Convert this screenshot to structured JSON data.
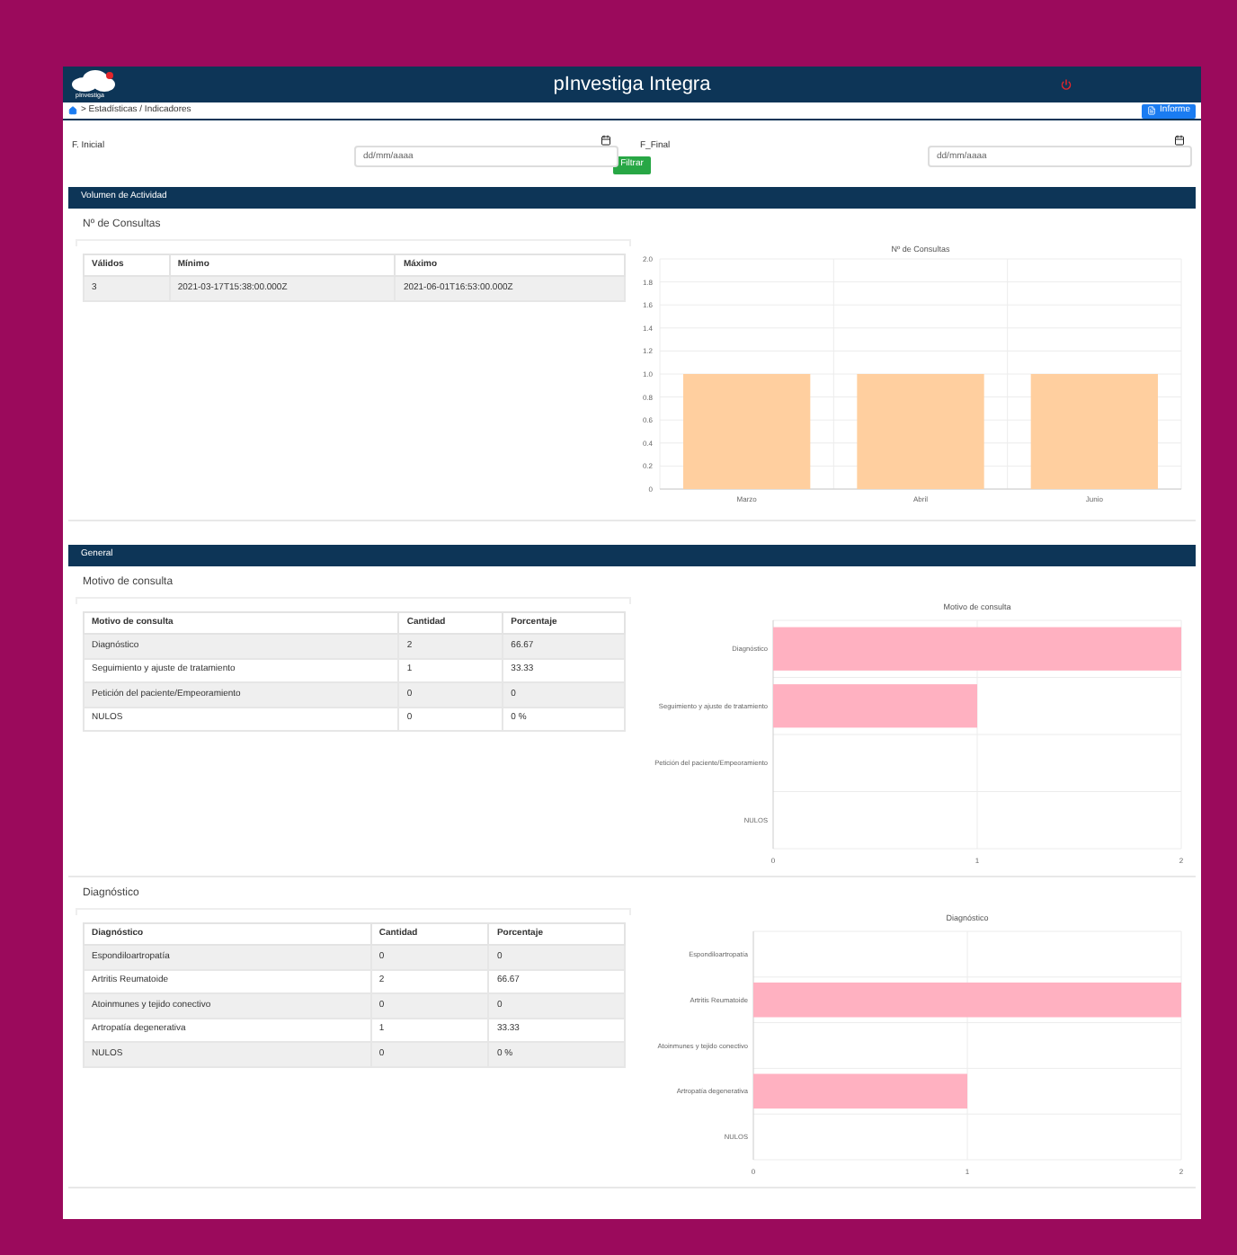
{
  "header": {
    "logo_text": "pInvestiga",
    "title": "pInvestiga Integra"
  },
  "breadcrumb": "> Estadísticas / Indicadores",
  "report_button": "Informe",
  "filters": [
    {
      "label": "F. Inicial",
      "placeholder": "dd/mm/aaaa"
    },
    {
      "label": "F_Final",
      "placeholder": "dd/mm/aaaa"
    }
  ],
  "filter_button": "Filtrar",
  "sections": [
    {
      "title": "Volumen de Actividad",
      "panels": [
        {
          "title": "Nº de Consultas",
          "table": {
            "columns": [
              "Válidos",
              "Mínimo",
              "Máximo"
            ],
            "rows": [
              [
                "3",
                "2021-03-17T15:38:00.000Z",
                "2021-06-01T16:53:00.000Z"
              ]
            ]
          },
          "chart_data": {
            "type": "bar",
            "orientation": "vertical",
            "title": "Nº de Consultas",
            "categories": [
              "Marzo",
              "Abril",
              "Junio"
            ],
            "series": [
              {
                "color": "#ffcf9f",
                "values": [
                  1,
                  1,
                  1
                ]
              }
            ],
            "grid": true,
            "ylim": [
              0,
              2
            ],
            "yticks": [
              0,
              0.2,
              0.4,
              0.6,
              0.8,
              {
                "value": 1,
                "label": "1.0"
              },
              1.2,
              1.4,
              1.6,
              1.8,
              {
                "value": 2,
                "label": "2.0"
              }
            ]
          }
        }
      ]
    },
    {
      "title": "General",
      "panels": [
        {
          "title": "Motivo de consulta",
          "table": {
            "columns": [
              "Motivo de consulta",
              "Cantidad",
              "Porcentaje"
            ],
            "rows": [
              [
                "Diagnóstico",
                "2",
                "66.67"
              ],
              [
                "Seguimiento y ajuste de tratamiento",
                "1",
                "33.33"
              ],
              [
                "Petición del paciente/Empeoramiento",
                "0",
                "0"
              ],
              [
                "NULOS",
                "0",
                "0 %"
              ]
            ]
          },
          "chart_data": {
            "type": "bar",
            "orientation": "horizontal",
            "title": "Motivo de consulta",
            "categories": [
              "Diagnóstico",
              "Seguimiento y ajuste de tratamiento",
              "Petición del paciente/Empeoramiento",
              "NULOS"
            ],
            "series": [
              {
                "color": "#ffb1c1",
                "values": [
                  2,
                  1,
                  0,
                  0
                ]
              }
            ],
            "grid": true,
            "xlim": [
              0,
              2
            ],
            "xticks": [
              0,
              1,
              2
            ]
          }
        },
        {
          "title": "Diagnóstico",
          "table": {
            "columns": [
              "Diagnóstico",
              "Cantidad",
              "Porcentaje"
            ],
            "rows": [
              [
                "Espondiloartropatía",
                "0",
                "0"
              ],
              [
                "Artritis Reumatoide",
                "2",
                "66.67"
              ],
              [
                "Atoinmunes y tejido conectivo",
                "0",
                "0"
              ],
              [
                "Artropatía degenerativa",
                "1",
                "33.33"
              ],
              [
                "NULOS",
                "0",
                "0 %"
              ]
            ]
          },
          "chart_data": {
            "type": "bar",
            "orientation": "horizontal",
            "title": "Diagnóstico",
            "categories": [
              "Espondiloartropatía",
              "Artritis Reumatoide",
              "Atoinmunes y tejido conectivo",
              "Artropatía degenerativa",
              "NULOS"
            ],
            "series": [
              {
                "color": "#ffb1c1",
                "values": [
                  0,
                  2,
                  0,
                  1,
                  0
                ]
              }
            ],
            "grid": true,
            "xlim": [
              0,
              2
            ],
            "xticks": [
              0,
              1,
              2
            ]
          }
        }
      ]
    }
  ]
}
